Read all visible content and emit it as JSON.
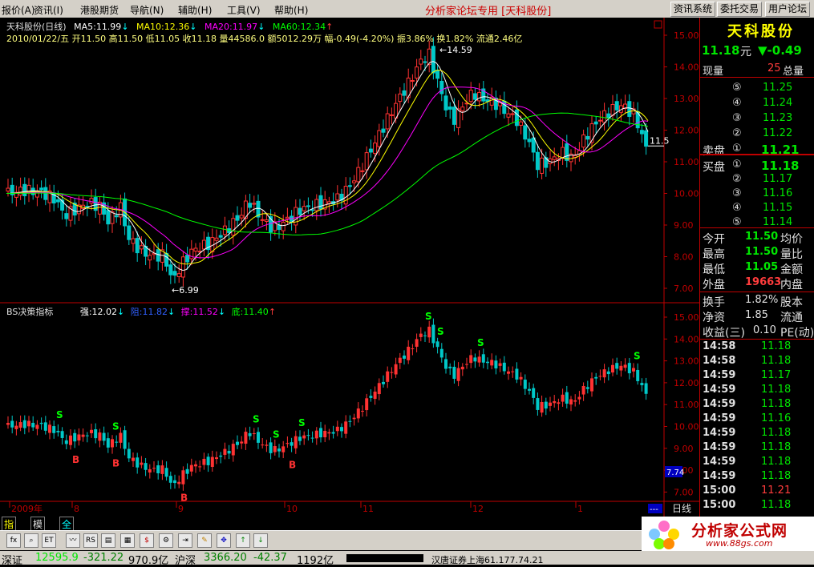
{
  "menu": {
    "items": [
      "报价(A)",
      "资讯(I)",
      "港股期货",
      "导航(N)",
      "辅助(H)",
      "工具(V)",
      "帮助(H)"
    ],
    "center_title": "分析家论坛专用 [天科股份]",
    "buttons": [
      "资讯系统",
      "委托交易",
      "用户论坛"
    ]
  },
  "main_chart": {
    "title": "天科股份(日线)",
    "ma5": "MA5:11.99",
    "ma10": "MA10:12.36",
    "ma20": "MA20:11.97",
    "ma60": "MA60:12.34",
    "info_line": "2010/01/22/五 开11.50 高11.50 低11.05 收11.18 量44586.0 额5012.29万 幅-0.49(-4.20%) 振3.86% 换1.82% 流通2.46亿",
    "high_label": "14.59",
    "low_label": "6.99",
    "last_label": "11.5",
    "yticks": [
      "15.00",
      "14.00",
      "13.00",
      "12.00",
      "11.00",
      "10.00",
      "9.00",
      "8.00",
      "7.00"
    ],
    "colors": {
      "up": "#ff3232",
      "down": "#00c8c8",
      "ma5": "#ffffff",
      "ma10": "#ffff00",
      "ma20": "#ff00ff",
      "ma60": "#00ff00"
    }
  },
  "bs_chart": {
    "title": "BS决策指标",
    "strong": "强:12.02",
    "resist": "阻:11.82",
    "support": "撑:11.52",
    "bottom": "底:11.40",
    "yticks": [
      "15.00",
      "14.00",
      "13.00",
      "12.00",
      "11.00",
      "10.00",
      "9.00",
      "8.00",
      "7.00"
    ],
    "current_value": "7.74",
    "signal_s": "S",
    "signal_b": "B"
  },
  "xaxis": {
    "labels": [
      "2009年",
      "8",
      "9",
      "10",
      "11",
      "12",
      "1"
    ],
    "period": "日线",
    "dash": "---"
  },
  "quote": {
    "name": "天科股份",
    "price": "11.18",
    "unit": "元",
    "change": "▼-0.49",
    "now_vol_label": "现量",
    "now_vol": "25",
    "total_vol_label": "总量",
    "sell_label": "卖盘",
    "buy_label": "买盘",
    "sells": [
      {
        "idx": "⑤",
        "price": "11.25"
      },
      {
        "idx": "④",
        "price": "11.24"
      },
      {
        "idx": "③",
        "price": "11.23"
      },
      {
        "idx": "②",
        "price": "11.22"
      },
      {
        "idx": "①",
        "price": "11.21"
      }
    ],
    "buys": [
      {
        "idx": "①",
        "price": "11.18"
      },
      {
        "idx": "②",
        "price": "11.17"
      },
      {
        "idx": "③",
        "price": "11.16"
      },
      {
        "idx": "④",
        "price": "11.15"
      },
      {
        "idx": "⑤",
        "price": "11.14"
      }
    ],
    "stats": [
      {
        "k": "今开",
        "v": "11.50",
        "k2": "均价"
      },
      {
        "k": "最高",
        "v": "11.50",
        "k2": "量比"
      },
      {
        "k": "最低",
        "v": "11.05",
        "k2": "金额"
      },
      {
        "k": "外盘",
        "v": "19663",
        "k2": "内盘"
      }
    ],
    "stats2": [
      {
        "k": "换手",
        "v": "1.82%",
        "k2": "股本"
      },
      {
        "k": "净资",
        "v": "1.85",
        "k2": "流通"
      },
      {
        "k": "收益(三)",
        "v": "0.10",
        "k2": "PE(动)"
      }
    ],
    "ticks": [
      {
        "t": "14:58",
        "p": "11.18"
      },
      {
        "t": "14:58",
        "p": "11.18"
      },
      {
        "t": "14:59",
        "p": "11.17"
      },
      {
        "t": "14:59",
        "p": "11.18"
      },
      {
        "t": "14:59",
        "p": "11.18"
      },
      {
        "t": "14:59",
        "p": "11.16"
      },
      {
        "t": "14:59",
        "p": "11.18"
      },
      {
        "t": "14:59",
        "p": "11.18"
      },
      {
        "t": "14:59",
        "p": "11.18"
      },
      {
        "t": "14:59",
        "p": "11.18"
      },
      {
        "t": "15:00",
        "p": "11.21"
      },
      {
        "t": "15:00",
        "p": "11.18"
      }
    ]
  },
  "tabs": [
    "指标",
    "模板",
    "全部"
  ],
  "status": {
    "sz_label": "深证",
    "sz_index": "12595.9",
    "sz_change": "-321.22",
    "sz_amount": "970.9亿",
    "hs_label": "沪深",
    "hs_index": "3366.20",
    "hs_change": "-42.37",
    "hs_amount": "1192亿",
    "ticker": "汉唐证券上海61.177.74.21"
  },
  "brand": {
    "name": "分析家公式网",
    "url": "www.88gs.com"
  }
}
